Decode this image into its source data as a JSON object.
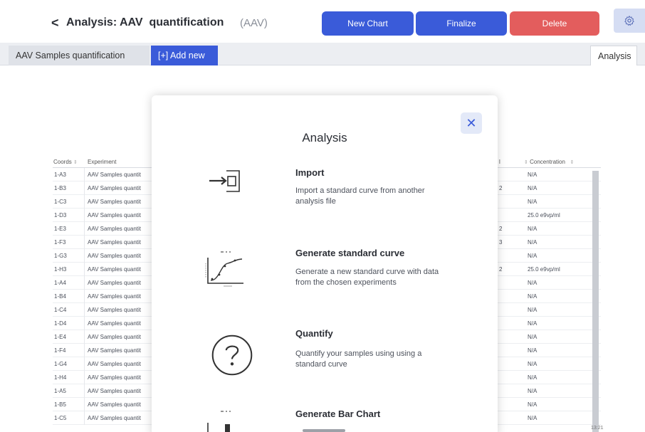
{
  "header": {
    "back_glyph": "<",
    "title": "Analysis: AAV  quantification",
    "subtitle": "(AAV)",
    "new_chart_label": "New Chart",
    "finalize_label": "Finalize",
    "delete_label": "Delete",
    "gear_icon": "gear-icon"
  },
  "tabs": {
    "samples_label": "AAV  Samples quantification",
    "add_label": "[+] Add new",
    "analysis_label": "Analysis"
  },
  "table": {
    "headers": {
      "coords": "Coords",
      "experiment": "Experiment",
      "col": "l",
      "concentration": "Concentration"
    },
    "rows": [
      {
        "coord": "1-A3",
        "experiment": "AAV  Samples quantit",
        "mark": "",
        "conc": "N/A"
      },
      {
        "coord": "1-B3",
        "experiment": "AAV  Samples quantit",
        "mark": "2",
        "conc": "N/A"
      },
      {
        "coord": "1-C3",
        "experiment": "AAV  Samples quantit",
        "mark": "",
        "conc": "N/A"
      },
      {
        "coord": "1-D3",
        "experiment": "AAV  Samples quantit",
        "mark": "",
        "conc": "25.0  e9vp/ml"
      },
      {
        "coord": "1-E3",
        "experiment": "AAV  Samples quantit",
        "mark": "2",
        "conc": "N/A"
      },
      {
        "coord": "1-F3",
        "experiment": "AAV  Samples quantit",
        "mark": "3",
        "conc": "N/A"
      },
      {
        "coord": "1-G3",
        "experiment": "AAV  Samples quantit",
        "mark": "",
        "conc": "N/A"
      },
      {
        "coord": "1-H3",
        "experiment": "AAV  Samples quantit",
        "mark": "2",
        "conc": "25.0  e9vp/ml"
      },
      {
        "coord": "1-A4",
        "experiment": "AAV  Samples quantit",
        "mark": "",
        "conc": "N/A"
      },
      {
        "coord": "1-B4",
        "experiment": "AAV  Samples quantit",
        "mark": "",
        "conc": "N/A"
      },
      {
        "coord": "1-C4",
        "experiment": "AAV  Samples quantit",
        "mark": "",
        "conc": "N/A"
      },
      {
        "coord": "1-D4",
        "experiment": "AAV  Samples quantit",
        "mark": "",
        "conc": "N/A"
      },
      {
        "coord": "1-E4",
        "experiment": "AAV  Samples quantit",
        "mark": "",
        "conc": "N/A"
      },
      {
        "coord": "1-F4",
        "experiment": "AAV  Samples quantit",
        "mark": "",
        "conc": "N/A"
      },
      {
        "coord": "1-G4",
        "experiment": "AAV  Samples quantit",
        "mark": "",
        "conc": "N/A"
      },
      {
        "coord": "1-H4",
        "experiment": "AAV  Samples quantit",
        "mark": "",
        "conc": "N/A"
      },
      {
        "coord": "1-A5",
        "experiment": "AAV  Samples quantit",
        "mark": "",
        "conc": "N/A"
      },
      {
        "coord": "1-B5",
        "experiment": "AAV  Samples quantit",
        "mark": "",
        "conc": "N/A"
      },
      {
        "coord": "1-C5",
        "experiment": "AAV  Samples quantit",
        "mark": "",
        "conc": "N/A"
      }
    ]
  },
  "modal": {
    "title": "Analysis",
    "close_glyph": "✕",
    "options": [
      {
        "title": "Import",
        "description": "Import a standard curve from another analysis file",
        "icon": "import-icon"
      },
      {
        "title": "Generate standard curve",
        "description": "Generate a new standard curve with data from the chosen experiments",
        "icon": "standard-curve-icon"
      },
      {
        "title": "Quantify",
        "description": "Quantify your samples using using a standard curve",
        "icon": "question-circle-icon"
      },
      {
        "title": "Generate Bar Chart",
        "description": "",
        "icon": "bar-chart-icon"
      }
    ]
  },
  "tray": {
    "time": "13:21"
  },
  "colors": {
    "primary": "#3a5bd9",
    "danger": "#e35d5d",
    "tab_bg": "#eceef2"
  }
}
